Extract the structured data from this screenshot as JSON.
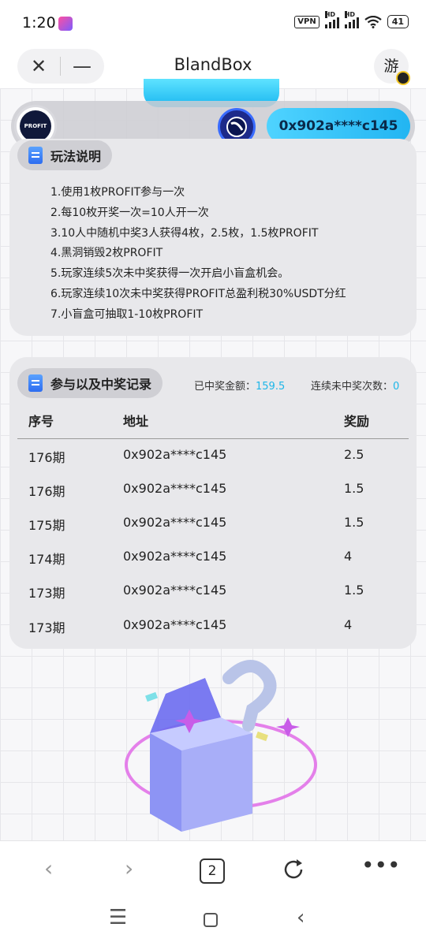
{
  "status_bar": {
    "time": "1:20",
    "vpn": "VPN",
    "hd": "HD",
    "battery": "41"
  },
  "browser": {
    "title": "BlandBox",
    "close_icon": "close-icon",
    "minimize_icon": "minus-icon",
    "game_label": "游",
    "tab_count": "2"
  },
  "header": {
    "logo_text": "PROFIT",
    "wallet_address": "0x902a****c145"
  },
  "rules": {
    "title": "玩法说明",
    "items": [
      "1.使用1枚PROFIT参与一次",
      "2.每10枚开奖一次=10人开一次",
      "3.10人中随机中奖3人获得4枚，2.5枚，1.5枚PROFIT",
      "4.黑洞销毁2枚PROFIT",
      "5.玩家连续5次未中奖获得一次开启小盲盒机会。",
      "6.玩家连续10次未中奖获得PROFIT总盈利税30%USDT分红",
      "7.小盲盒可抽取1-10枚PROFIT"
    ]
  },
  "records": {
    "title": "参与以及中奖记录",
    "won_amount_label": "已中奖金额：",
    "won_amount": "159.5",
    "streak_label": "连续未中奖次数：",
    "streak": "0",
    "columns": [
      "序号",
      "地址",
      "奖励"
    ],
    "rows": [
      [
        "176期",
        "0x902a****c145",
        "2.5"
      ],
      [
        "176期",
        "0x902a****c145",
        "1.5"
      ],
      [
        "175期",
        "0x902a****c145",
        "1.5"
      ],
      [
        "174期",
        "0x902a****c145",
        "4"
      ],
      [
        "173期",
        "0x902a****c145",
        "1.5"
      ],
      [
        "173期",
        "0x902a****c145",
        "4"
      ]
    ]
  },
  "colors": {
    "accent": "#22b5f2",
    "value_text": "#1eb6e8",
    "card_bg": "#e8e8eb"
  }
}
